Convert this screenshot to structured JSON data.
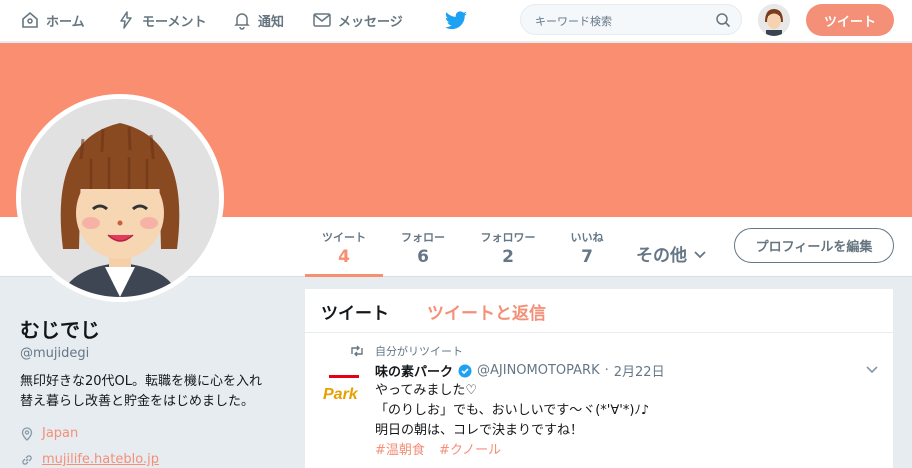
{
  "nav": {
    "home": "ホーム",
    "moments": "モーメント",
    "notifications": "通知",
    "messages": "メッセージ",
    "search_placeholder": "キーワード検索",
    "tweet_button": "ツイート"
  },
  "colors": {
    "accent": "#fa8e71",
    "link": "#f48f78",
    "twitter_blue": "#1da1f2"
  },
  "profile": {
    "name": "むじでじ",
    "handle": "@mujidegi",
    "bio_line1": "無印好きな20代OL。転職を機に心を入れ",
    "bio_line2": "替え暮らし改善と貯金をはじめました。",
    "location": "Japan",
    "url": "mujilife.hateblo.jp",
    "edit_button": "プロフィールを編集"
  },
  "stats": [
    {
      "label": "ツイート",
      "value": "4"
    },
    {
      "label": "フォロー",
      "value": "6"
    },
    {
      "label": "フォロワー",
      "value": "2"
    },
    {
      "label": "いいね",
      "value": "7"
    }
  ],
  "more_label": "その他",
  "timeline": {
    "tab_tweets": "ツイート",
    "tab_replies": "ツイートと返信",
    "tweet": {
      "retweet_context": "自分がリツイート",
      "author_name": "味の素パーク",
      "author_handle": "@AJINOMOTOPARK",
      "dot": "·",
      "date": "2月22日",
      "line1": "やってみました♡",
      "line2": "「のりしお」でも、おいしいです〜ヾ(*'∀'*)ﾉ♪",
      "line3": "明日の朝は、コレで決まりですね！",
      "hashtag1": "#温朝食",
      "hashtag2": "#クノール",
      "avatar_logo": "Park"
    }
  }
}
